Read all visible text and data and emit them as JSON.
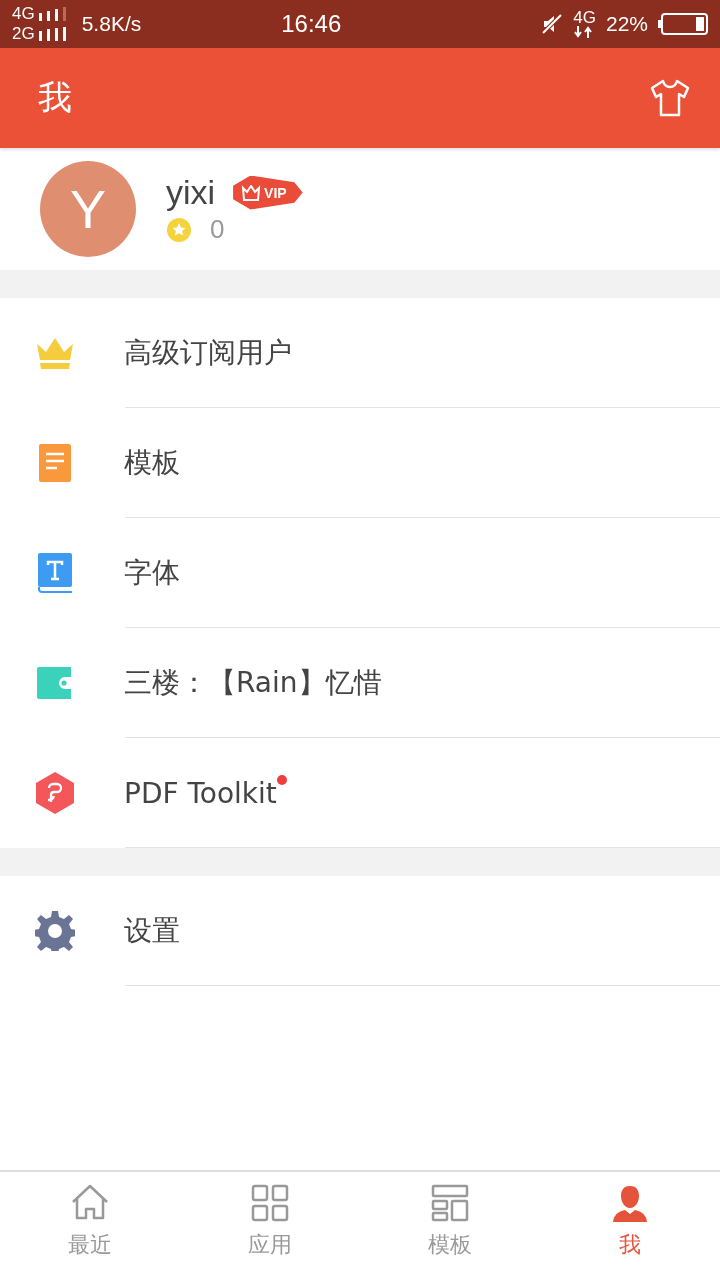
{
  "status_bar": {
    "network_top": "4G",
    "network_bottom": "2G",
    "speed": "5.8K/s",
    "time": "16:46",
    "data_type": "4G",
    "battery": "22%"
  },
  "header": {
    "title": "我"
  },
  "profile": {
    "avatar_letter": "Y",
    "name": "yixi",
    "badge": "VIP",
    "points": "0"
  },
  "menu_groups": [
    {
      "items": [
        {
          "kind": "crown",
          "label": "高级订阅用户",
          "dot": false
        },
        {
          "kind": "document",
          "label": "模板",
          "dot": false
        },
        {
          "kind": "font",
          "label": "字体",
          "dot": false
        },
        {
          "kind": "wallet",
          "label": "三楼：【Rain】忆惜",
          "dot": false
        },
        {
          "kind": "pdf",
          "label": "PDF Toolkit",
          "dot": true
        }
      ]
    },
    {
      "items": [
        {
          "kind": "gear",
          "label": "设置",
          "dot": false
        }
      ]
    }
  ],
  "tabs": [
    {
      "kind": "home",
      "label": "最近",
      "selected": false
    },
    {
      "kind": "grid",
      "label": "应用",
      "selected": false
    },
    {
      "kind": "layout",
      "label": "模板",
      "selected": false
    },
    {
      "kind": "person",
      "label": "我",
      "selected": true
    }
  ]
}
